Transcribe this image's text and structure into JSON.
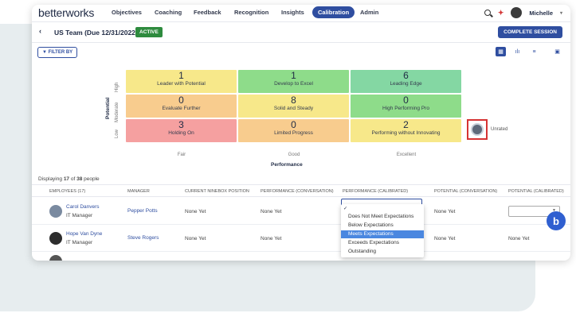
{
  "nav": {
    "logo": "betterworks",
    "items": [
      "Objectives",
      "Coaching",
      "Feedback",
      "Recognition",
      "Insights",
      "Calibration",
      "Admin"
    ],
    "user": "Michelle",
    "user_caret": "▾"
  },
  "header": {
    "back_icon": "‹",
    "team": "US Team (Due 12/31/2022)",
    "status_badge": "ACTIVE",
    "complete_button": "COMPLETE SESSION"
  },
  "filter_button": "FILTER BY",
  "ninebox": {
    "rows": [
      [
        {
          "count": "1",
          "label": "Leader with Potential",
          "color": "#f7e88a"
        },
        {
          "count": "1",
          "label": "Develop to Excel",
          "color": "#8edc8a"
        },
        {
          "count": "6",
          "label": "Leading Edge",
          "color": "#84d7a3"
        }
      ],
      [
        {
          "count": "0",
          "label": "Evaluate Further",
          "color": "#f8cc8e"
        },
        {
          "count": "8",
          "label": "Solid and Steady",
          "color": "#f7e88a"
        },
        {
          "count": "0",
          "label": "High Performing Pro",
          "color": "#8edc8a"
        }
      ],
      [
        {
          "count": "3",
          "label": "Holding On",
          "color": "#f5a0a0"
        },
        {
          "count": "0",
          "label": "Limited Progress",
          "color": "#f8cc8e"
        },
        {
          "count": "2",
          "label": "Performing without Innovating",
          "color": "#f7e88a"
        }
      ]
    ],
    "y_labels": [
      "High",
      "Moderate",
      "Low"
    ],
    "y_title": "Potential",
    "x_labels": [
      "Fair",
      "Good",
      "Excellent"
    ],
    "x_title": "Performance",
    "unrated_label": "Unrated"
  },
  "displaying": {
    "prefix": "Displaying",
    "shown": "17",
    "of": "of",
    "total": "38",
    "suffix": "people"
  },
  "table": {
    "headers": [
      "EMPLOYEES (17)",
      "MANAGER",
      "CURRENT NINEBOX POSITION",
      "PERFORMANCE (CONVERSATION)",
      "PERFORMANCE (CALIBRATED)",
      "POTENTIAL (CONVERSATION)",
      "POTENTIAL (CALIBRATED)"
    ],
    "rows": [
      {
        "name": "Carol Danvers",
        "title": "IT Manager",
        "manager": "Pepper Potts",
        "ninebox": "None Yet",
        "perf_conv": "None Yet",
        "pot_conv": "None Yet",
        "pot_cal": ""
      },
      {
        "name": "Hope Van Dyne",
        "title": "IT Manager",
        "manager": "Steve Rogers",
        "ninebox": "None Yet",
        "perf_conv": "None Yet",
        "pot_conv": "None Yet",
        "pot_cal": "None Yet"
      }
    ]
  },
  "dropdown": {
    "options": [
      "Does Not Meet Expectations",
      "Below Expectations",
      "Meets Expectations",
      "Exceeds Expectations",
      "Outstanding"
    ],
    "selected_index": 2
  }
}
